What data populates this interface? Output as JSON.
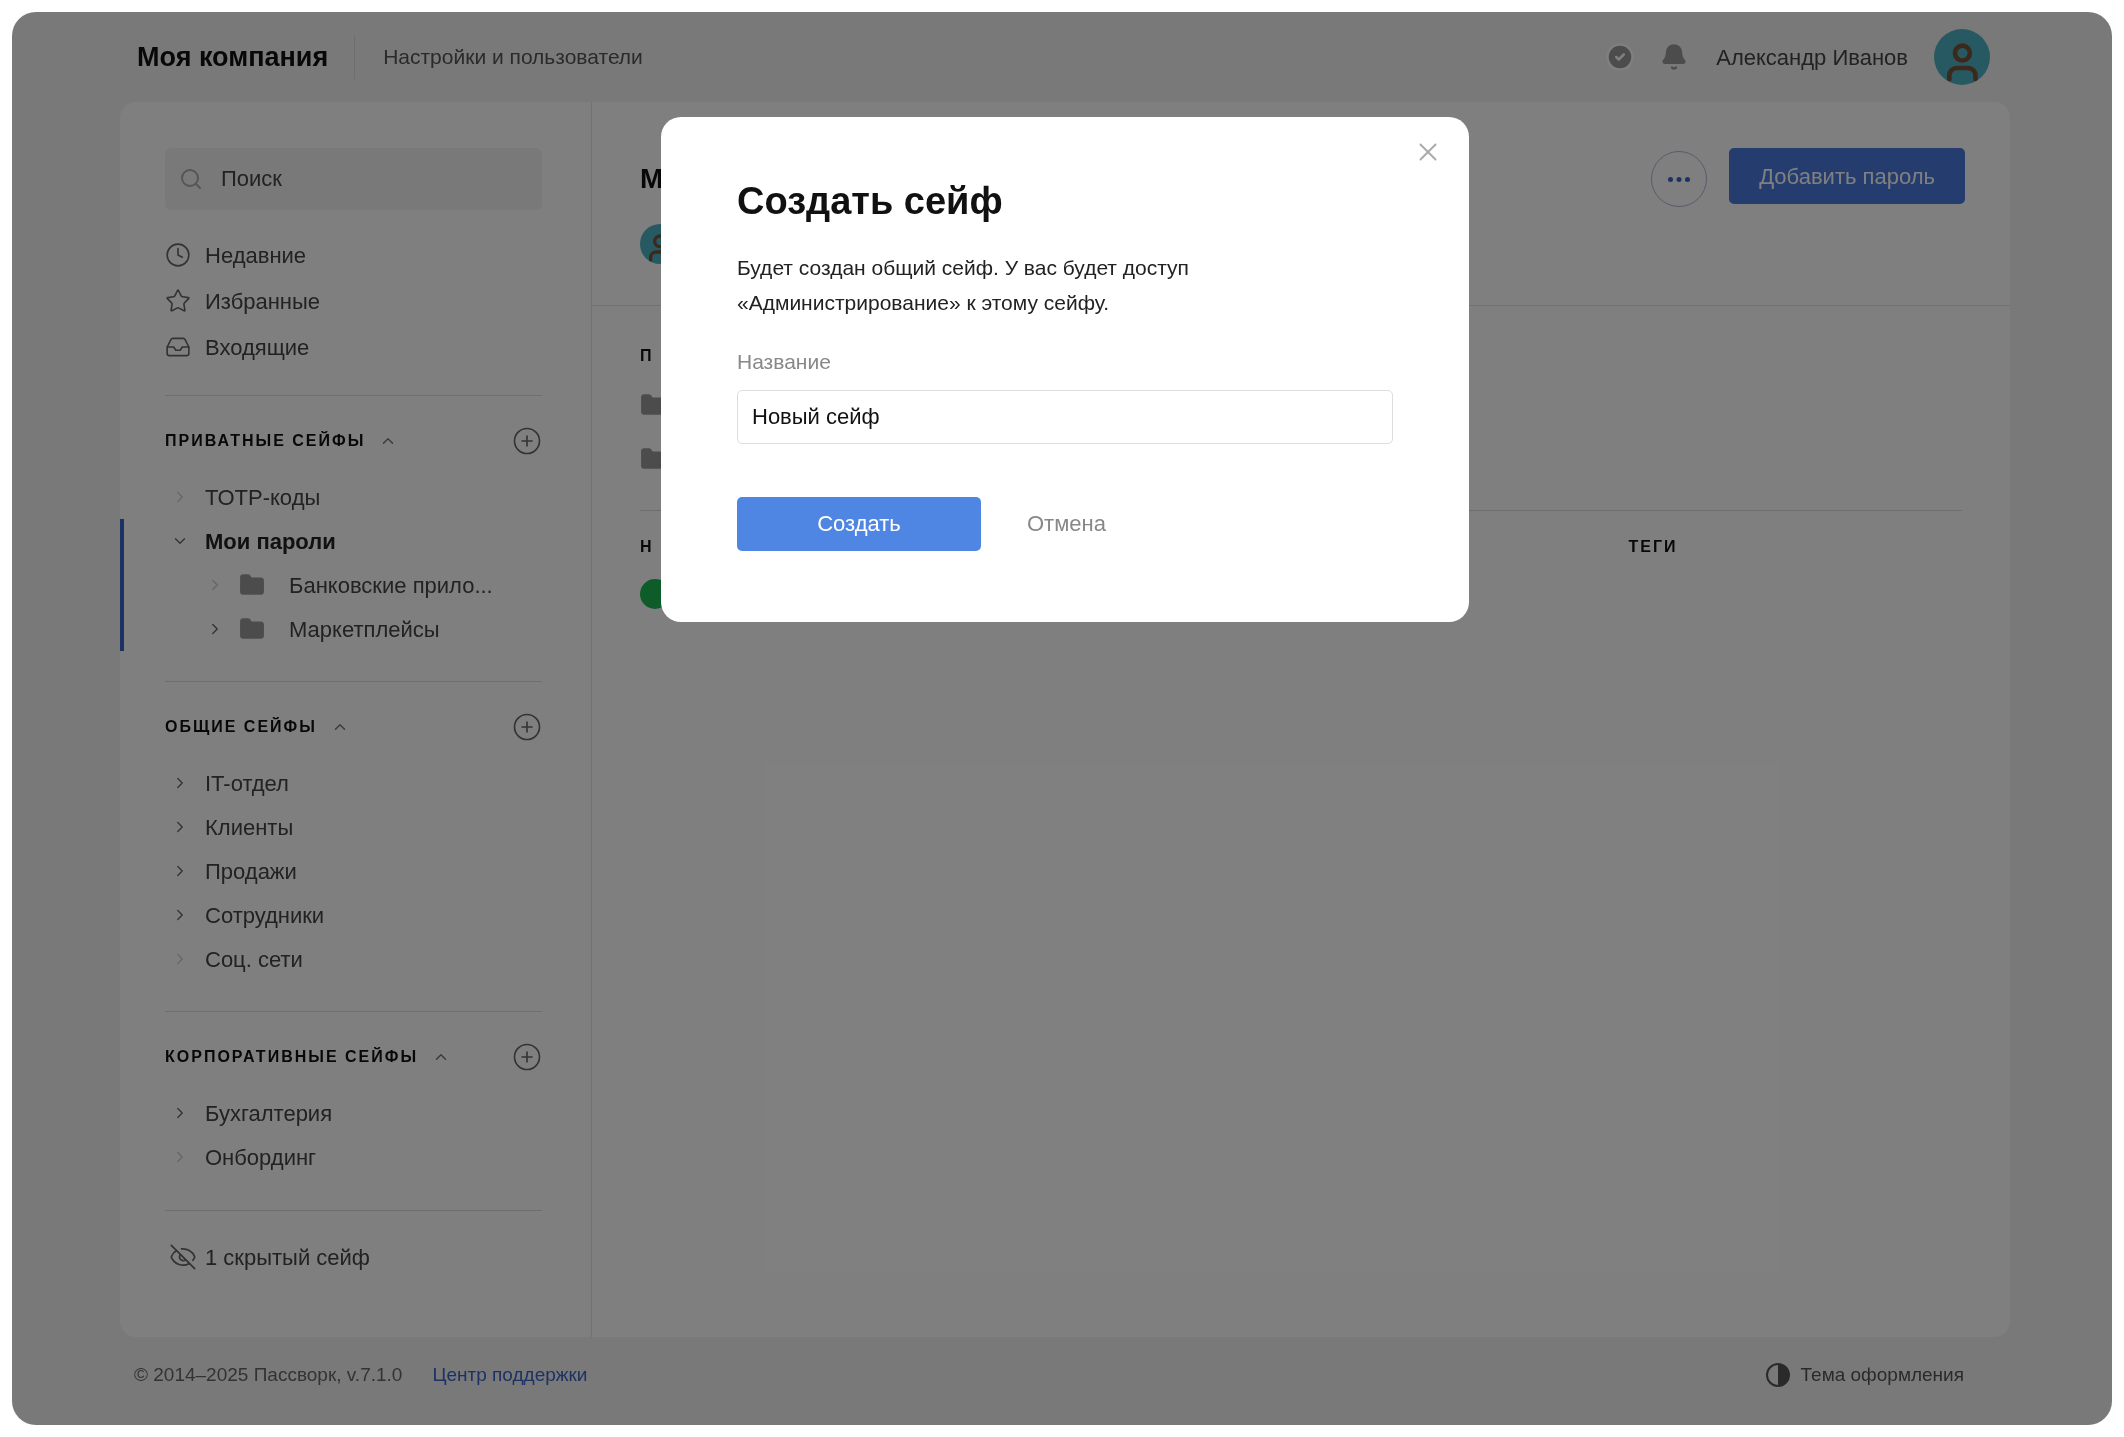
{
  "header": {
    "company": "Моя компания",
    "section": "Настройки и пользователи",
    "user_name": "Александр Иванов"
  },
  "sidebar": {
    "search": {
      "placeholder": "Поиск"
    },
    "nav": [
      {
        "label": "Недавние"
      },
      {
        "label": "Избранные"
      },
      {
        "label": "Входящие"
      }
    ],
    "groups": [
      {
        "title": "ПРИВАТНЫЕ СЕЙФЫ",
        "expanded": true,
        "items": [
          {
            "label": "ТОТР-коды",
            "expandable": false,
            "expanded": false,
            "selected": false
          },
          {
            "label": "Мои пароли",
            "expandable": true,
            "expanded": true,
            "selected": true,
            "children": [
              {
                "label": "Банковские прило...",
                "expandable": false,
                "expanded": false,
                "selected": false
              },
              {
                "label": "Маркетплейсы",
                "expandable": true,
                "expanded": false,
                "selected": false
              }
            ]
          }
        ]
      },
      {
        "title": "ОБЩИЕ СЕЙФЫ",
        "expanded": true,
        "items": [
          {
            "label": "IT-отдел",
            "expandable": true,
            "expanded": false,
            "selected": false
          },
          {
            "label": "Клиенты",
            "expandable": true,
            "expanded": false,
            "selected": false
          },
          {
            "label": "Продажи",
            "expandable": true,
            "expanded": false,
            "selected": false
          },
          {
            "label": "Сотрудники",
            "expandable": true,
            "expanded": false,
            "selected": false
          },
          {
            "label": "Соц. сети",
            "expandable": false,
            "expanded": false,
            "selected": false
          }
        ]
      },
      {
        "title": "КОРПОРАТИВНЫЕ СЕЙФЫ",
        "expanded": true,
        "items": [
          {
            "label": "Бухгалтерия",
            "expandable": true,
            "expanded": false,
            "selected": false
          },
          {
            "label": "Онбординг",
            "expandable": false,
            "expanded": false,
            "selected": false
          }
        ]
      }
    ],
    "hidden_vaults": "1 скрытый сейф"
  },
  "main": {
    "title": "М",
    "section_heading": "П",
    "column_1": "Н",
    "column_tags": "ТЕГИ",
    "add_button": "Добавить пароль"
  },
  "dialog": {
    "title": "Создать сейф",
    "description": "Будет создан общий сейф. У вас будет доступ «Администрирование» к этому сейфу.",
    "field": {
      "label": "Название",
      "value": "Новый сейф"
    },
    "primary_button": "Создать",
    "cancel_button": "Отмена"
  },
  "footer": {
    "copyright": "© 2014–2025 Пассворк, v.7.1.0",
    "support_link": "Центр поддержки",
    "theme": "Тема оформления"
  }
}
